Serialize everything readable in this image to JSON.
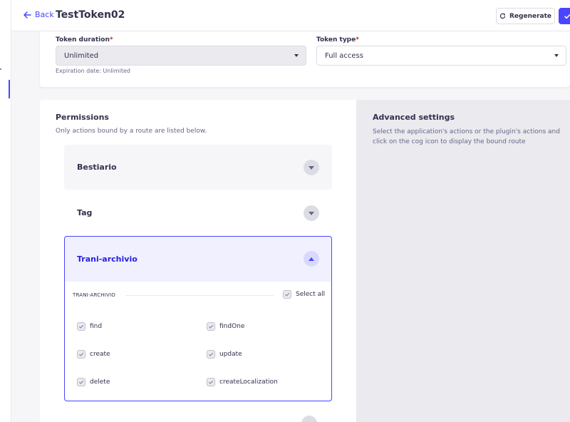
{
  "header": {
    "back_label": "Back",
    "title": "TestToken02",
    "regenerate_label": "Regenerate"
  },
  "details": {
    "duration": {
      "label": "Token duration",
      "required_mark": "*",
      "value": "Unlimited",
      "hint": "Expiration date: Unlimited"
    },
    "type": {
      "label": "Token type",
      "required_mark": "*",
      "value": "Full access"
    }
  },
  "permissions": {
    "title": "Permissions",
    "subtitle": "Only actions bound by a route are listed below.",
    "groups": [
      {
        "label": "Bestiario",
        "expanded": false
      },
      {
        "label": "Tag",
        "expanded": false
      },
      {
        "label": "Trani-archivio",
        "expanded": true,
        "section_label": "TRANI-ARCHIVIO",
        "select_all_label": "Select all",
        "actions": [
          {
            "label": "find"
          },
          {
            "label": "findOne"
          },
          {
            "label": "create"
          },
          {
            "label": "update"
          },
          {
            "label": "delete"
          },
          {
            "label": "createLocalization"
          }
        ]
      }
    ]
  },
  "advanced": {
    "title": "Advanced settings",
    "description": "Select the application's actions or the plugin's actions and click on the cog icon to display the bound route"
  },
  "colors": {
    "primary": "#4945ff",
    "primary_dark": "#271fe0",
    "required": "#d02b20"
  },
  "icons": {
    "back": "arrow-left-icon",
    "regenerate": "refresh-icon",
    "save": "check-icon",
    "select_caret": "caret-down-icon",
    "accordion_closed": "chevron-down-icon",
    "accordion_open": "chevron-up-icon",
    "checkbox_mark": "check-icon"
  }
}
